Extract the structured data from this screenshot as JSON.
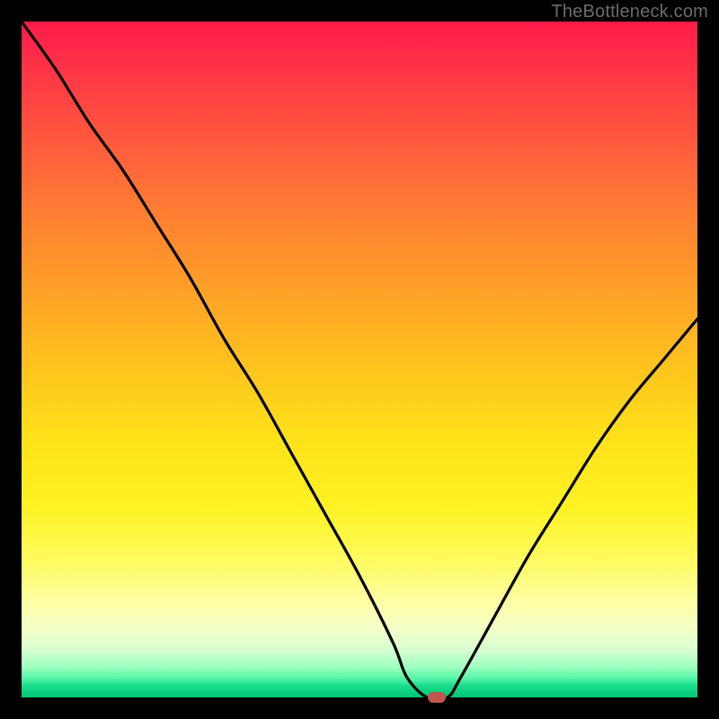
{
  "watermark": "TheBottleneck.com",
  "colors": {
    "frame": "#000000",
    "curve": "#000000",
    "marker": "#c0564d",
    "gradient_top": "#ff1b4b",
    "gradient_mid": "#ffe21a",
    "gradient_bottom": "#00c576"
  },
  "chart_data": {
    "type": "line",
    "title": "",
    "xlabel": "",
    "ylabel": "",
    "xlim": [
      0,
      100
    ],
    "ylim": [
      0,
      100
    ],
    "grid": false,
    "legend": false,
    "notes": "V-shaped bottleneck curve; y represents bottleneck severity (high = red top, low = green bottom). Minimum (optimal point) marked with a pill.",
    "x": [
      0,
      5,
      10,
      15,
      20,
      25,
      30,
      35,
      40,
      45,
      50,
      55,
      57,
      60,
      63,
      65,
      70,
      75,
      80,
      85,
      90,
      95,
      100
    ],
    "y": [
      100,
      93,
      85,
      78,
      70,
      62,
      53,
      45,
      36,
      27,
      18,
      8,
      3,
      0,
      0,
      3,
      12,
      21,
      29,
      37,
      44,
      50,
      56
    ],
    "marker": {
      "x": 61.5,
      "y": 0
    }
  }
}
